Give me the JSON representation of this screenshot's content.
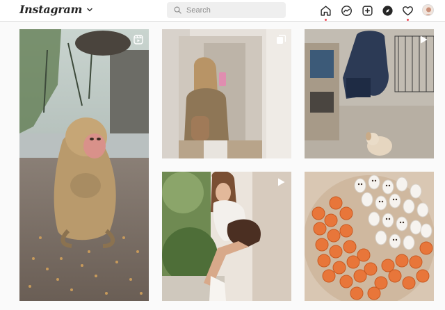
{
  "app": {
    "logo_text": "Instagram"
  },
  "search": {
    "placeholder": "Search"
  },
  "nav": [
    {
      "name": "home",
      "icon": "home-icon",
      "notification_dot": true
    },
    {
      "name": "direct",
      "icon": "messenger-icon",
      "notification_dot": false
    },
    {
      "name": "new-post",
      "icon": "plus-square-icon",
      "notification_dot": false
    },
    {
      "name": "explore",
      "icon": "compass-icon",
      "notification_dot": false
    },
    {
      "name": "activity",
      "icon": "heart-icon",
      "notification_dot": true
    },
    {
      "name": "profile",
      "icon": "avatar",
      "notification_dot": false
    }
  ],
  "posts": [
    {
      "subject": "monkey",
      "media_type": "reel",
      "badge_icon": "reels-icon"
    },
    {
      "subject": "mirror-selfie",
      "media_type": "carousel",
      "badge_icon": "carousel-icon"
    },
    {
      "subject": "puppy",
      "media_type": "video",
      "badge_icon": "play-icon"
    },
    {
      "subject": "woman-sitting",
      "media_type": "video",
      "badge_icon": "play-icon"
    },
    {
      "subject": "ghost-cookies",
      "media_type": "photo",
      "badge_icon": ""
    }
  ],
  "colors": {
    "accent_dot": "#ed4956",
    "border": "#dbdbdb",
    "background": "#fafafa",
    "search_bg": "#efefef"
  }
}
